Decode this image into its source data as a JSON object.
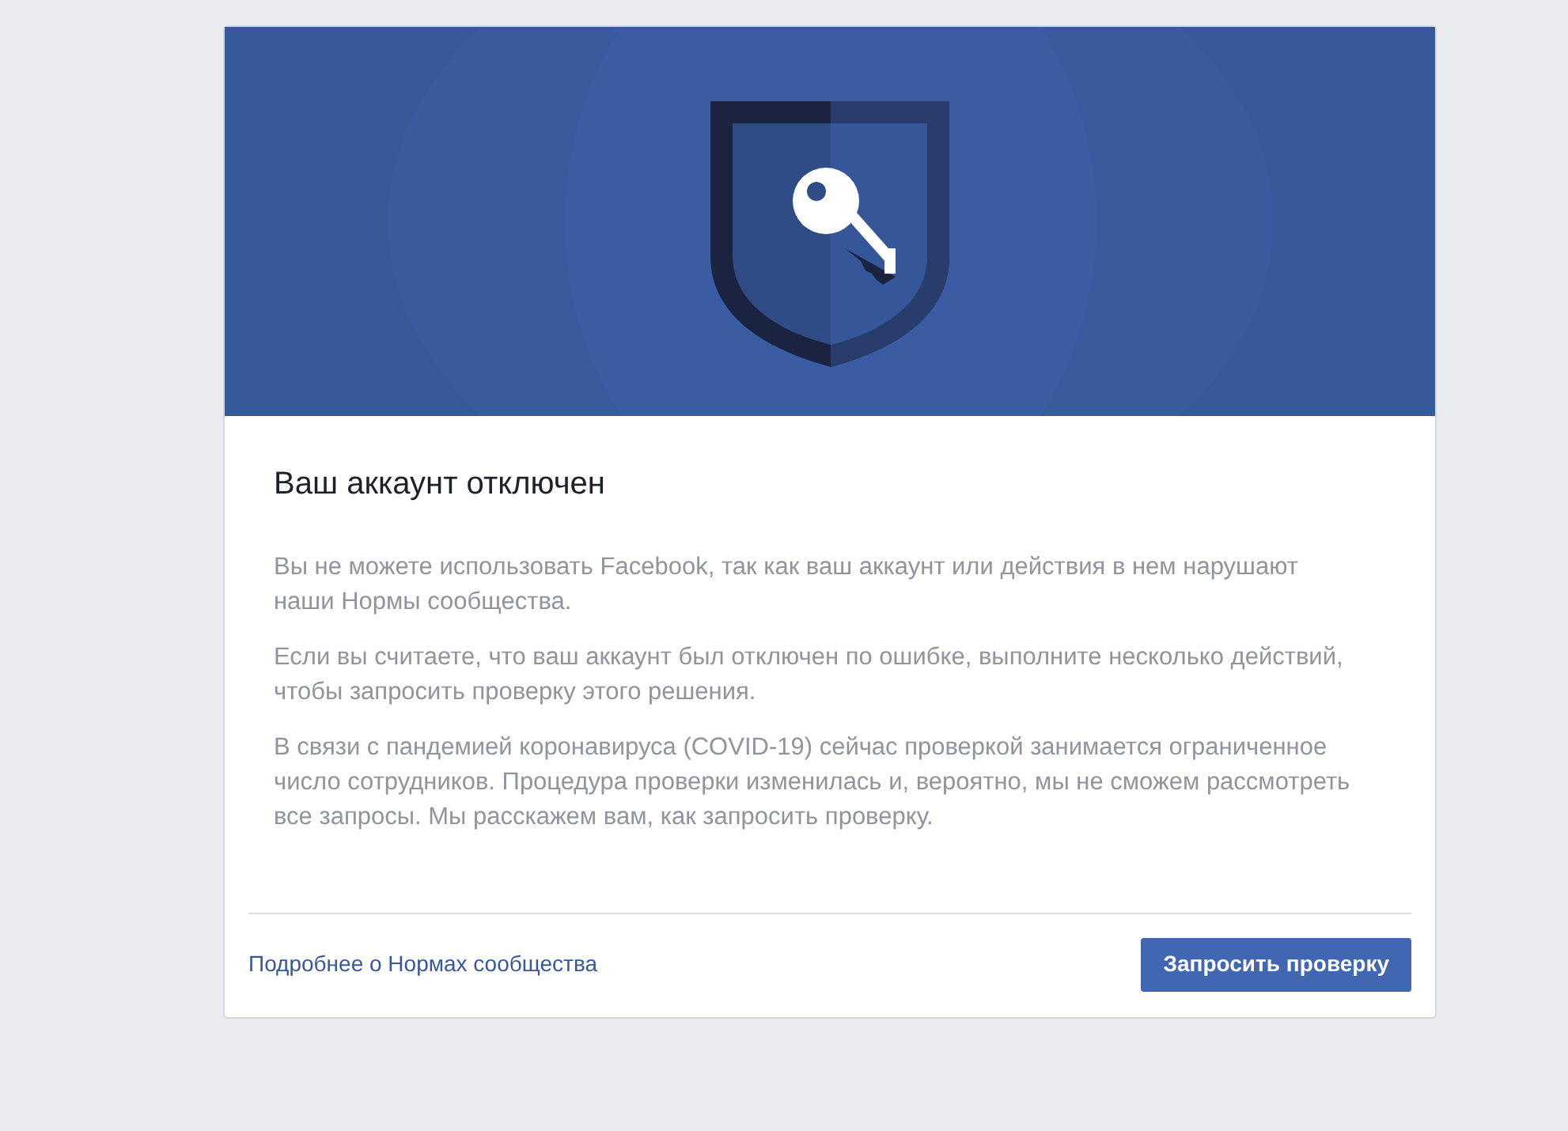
{
  "dialog": {
    "title": "Ваш аккаунт отключен",
    "paragraphs": [
      "Вы не можете использовать Facebook, так как ваш аккаунт или действия в нем нарушают наши Нормы сообщества.",
      "Если вы считаете, что ваш аккаунт был отключен по ошибке, выполните несколько действий, чтобы запросить проверку этого решения.",
      "В связи с пандемией коронавируса (COVID-19) сейчас проверкой занимается ограниченное число сотрудников. Процедура проверки изменилась и, вероятно, мы не сможем рассмотреть все запросы. Мы расскажем вам, как запросить проверку."
    ],
    "footer_link": "Подробнее о Нормах сообщества",
    "button": "Запросить проверку"
  }
}
